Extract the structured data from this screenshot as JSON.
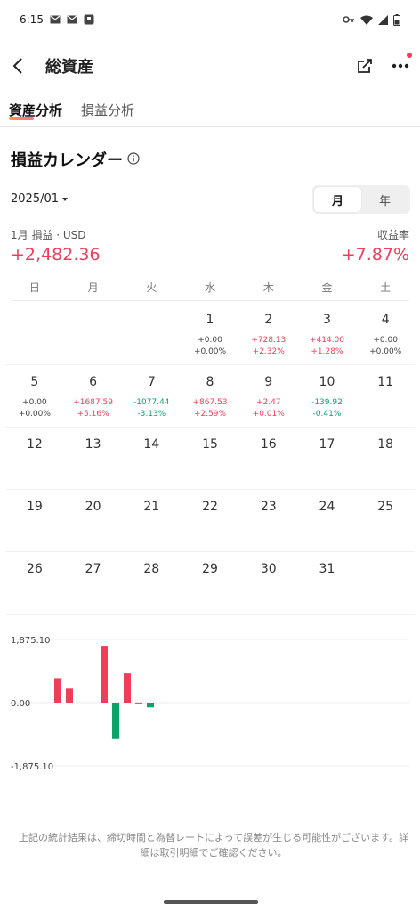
{
  "status_bar": {
    "time": "6:15"
  },
  "app_bar": {
    "title": "総資産"
  },
  "tabs": [
    {
      "label": "資産分析"
    },
    {
      "label": "損益分析"
    }
  ],
  "section": {
    "title": "損益カレンダー"
  },
  "period": {
    "selected": "2025/01",
    "toggle": [
      "月",
      "年"
    ],
    "active": "月"
  },
  "summary": {
    "pl_label": "1月 損益 · USD",
    "pl_value": "+2,482.36",
    "return_label": "収益率",
    "return_value": "+7.87%"
  },
  "weekdays": [
    "日",
    "月",
    "火",
    "水",
    "木",
    "金",
    "土"
  ],
  "calendar": [
    [
      {
        "day": "",
        "pl": "",
        "pct": "",
        "dir": ""
      },
      {
        "day": "",
        "pl": "",
        "pct": "",
        "dir": ""
      },
      {
        "day": "",
        "pl": "",
        "pct": "",
        "dir": ""
      },
      {
        "day": "1",
        "pl": "+0.00",
        "pct": "+0.00%",
        "dir": "flat"
      },
      {
        "day": "2",
        "pl": "+728.13",
        "pct": "+2.32%",
        "dir": "up"
      },
      {
        "day": "3",
        "pl": "+414.00",
        "pct": "+1.28%",
        "dir": "up"
      },
      {
        "day": "4",
        "pl": "+0.00",
        "pct": "+0.00%",
        "dir": "flat"
      }
    ],
    [
      {
        "day": "5",
        "pl": "+0.00",
        "pct": "+0.00%",
        "dir": "flat"
      },
      {
        "day": "6",
        "pl": "+1687.59",
        "pct": "+5.16%",
        "dir": "up"
      },
      {
        "day": "7",
        "pl": "-1077.44",
        "pct": "-3.13%",
        "dir": "down"
      },
      {
        "day": "8",
        "pl": "+867.53",
        "pct": "+2.59%",
        "dir": "up"
      },
      {
        "day": "9",
        "pl": "+2.47",
        "pct": "+0.01%",
        "dir": "up"
      },
      {
        "day": "10",
        "pl": "-139.92",
        "pct": "-0.41%",
        "dir": "down"
      },
      {
        "day": "11",
        "pl": "",
        "pct": "",
        "dir": ""
      }
    ],
    [
      {
        "day": "12",
        "pl": "",
        "pct": "",
        "dir": ""
      },
      {
        "day": "13",
        "pl": "",
        "pct": "",
        "dir": ""
      },
      {
        "day": "14",
        "pl": "",
        "pct": "",
        "dir": ""
      },
      {
        "day": "15",
        "pl": "",
        "pct": "",
        "dir": ""
      },
      {
        "day": "16",
        "pl": "",
        "pct": "",
        "dir": ""
      },
      {
        "day": "17",
        "pl": "",
        "pct": "",
        "dir": ""
      },
      {
        "day": "18",
        "pl": "",
        "pct": "",
        "dir": ""
      }
    ],
    [
      {
        "day": "19",
        "pl": "",
        "pct": "",
        "dir": ""
      },
      {
        "day": "20",
        "pl": "",
        "pct": "",
        "dir": ""
      },
      {
        "day": "21",
        "pl": "",
        "pct": "",
        "dir": ""
      },
      {
        "day": "22",
        "pl": "",
        "pct": "",
        "dir": ""
      },
      {
        "day": "23",
        "pl": "",
        "pct": "",
        "dir": ""
      },
      {
        "day": "24",
        "pl": "",
        "pct": "",
        "dir": ""
      },
      {
        "day": "25",
        "pl": "",
        "pct": "",
        "dir": ""
      }
    ],
    [
      {
        "day": "26",
        "pl": "",
        "pct": "",
        "dir": ""
      },
      {
        "day": "27",
        "pl": "",
        "pct": "",
        "dir": ""
      },
      {
        "day": "28",
        "pl": "",
        "pct": "",
        "dir": ""
      },
      {
        "day": "29",
        "pl": "",
        "pct": "",
        "dir": ""
      },
      {
        "day": "30",
        "pl": "",
        "pct": "",
        "dir": ""
      },
      {
        "day": "31",
        "pl": "",
        "pct": "",
        "dir": ""
      },
      {
        "day": "",
        "pl": "",
        "pct": "",
        "dir": ""
      }
    ]
  ],
  "chart_data": {
    "type": "bar",
    "categories": [
      "1",
      "2",
      "3",
      "4",
      "5",
      "6",
      "7",
      "8",
      "9",
      "10"
    ],
    "values": [
      0.0,
      728.13,
      414.0,
      0.0,
      0.0,
      1687.59,
      -1077.44,
      867.53,
      2.47,
      -139.92
    ],
    "ylim": [
      -1875.1,
      1875.1
    ],
    "tick_labels": [
      "1,875.10",
      "0.00",
      "-1,875.10"
    ],
    "colors": {
      "up": "#ef3f58",
      "down": "#0aa36a"
    },
    "grid": true
  },
  "colors": {
    "accent": "#ef3f58",
    "positive": "#ef3f58",
    "negative": "#0aa36a"
  },
  "footer": {
    "note": "上記の統計結果は、締切時間と為替レートによって誤差が生じる可能性がございます。詳細は取引明細でご確認ください。"
  }
}
